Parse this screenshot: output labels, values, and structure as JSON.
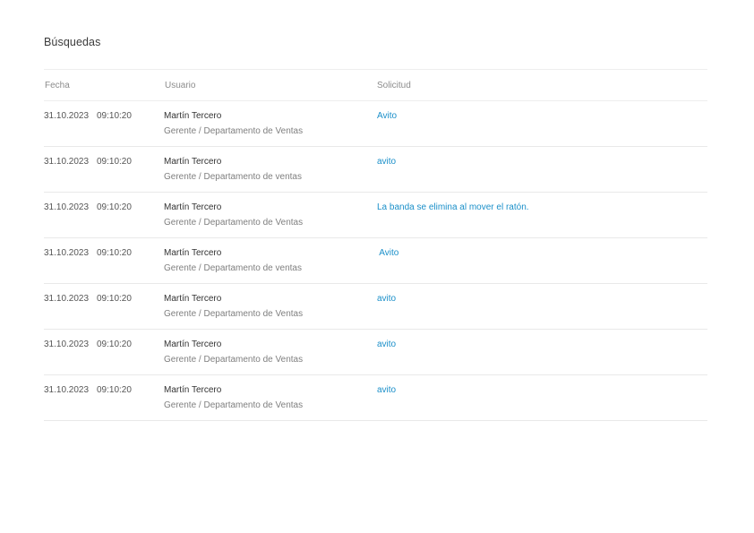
{
  "page": {
    "title": "Búsquedas"
  },
  "table": {
    "headers": {
      "fecha": "Fecha",
      "usuario": "Usuario",
      "solicitud": "Solicitud"
    },
    "rows": [
      {
        "date": "31.10.2023",
        "time": "09:10:20",
        "user": "Martín Tercero",
        "role": "Gerente / Departamento de Ventas",
        "query": "Avito"
      },
      {
        "date": "31.10.2023",
        "time": "09:10:20",
        "user": "Martín Tercero",
        "role": "Gerente / Departamento de ventas",
        "query": "avito"
      },
      {
        "date": "31.10.2023",
        "time": "09:10:20",
        "user": "Martín Tercero",
        "role": "Gerente / Departamento de Ventas",
        "query": "La banda se elimina al mover el ratón."
      },
      {
        "date": "31.10.2023",
        "time": "09:10:20",
        "user": "Martín Tercero",
        "role": "Gerente / Departamento de ventas",
        "query": " Avito"
      },
      {
        "date": "31.10.2023",
        "time": "09:10:20",
        "user": "Martín Tercero",
        "role": "Gerente / Departamento de Ventas",
        "query": "avito"
      },
      {
        "date": "31.10.2023",
        "time": "09:10:20",
        "user": "Martín Tercero",
        "role": "Gerente / Departamento de Ventas",
        "query": "avito"
      },
      {
        "date": "31.10.2023",
        "time": "09:10:20",
        "user": "Martín Tercero",
        "role": "Gerente / Departamento de Ventas",
        "query": "avito"
      }
    ]
  },
  "colors": {
    "link": "#1a8fc9",
    "divider": "#e9e9e9"
  }
}
